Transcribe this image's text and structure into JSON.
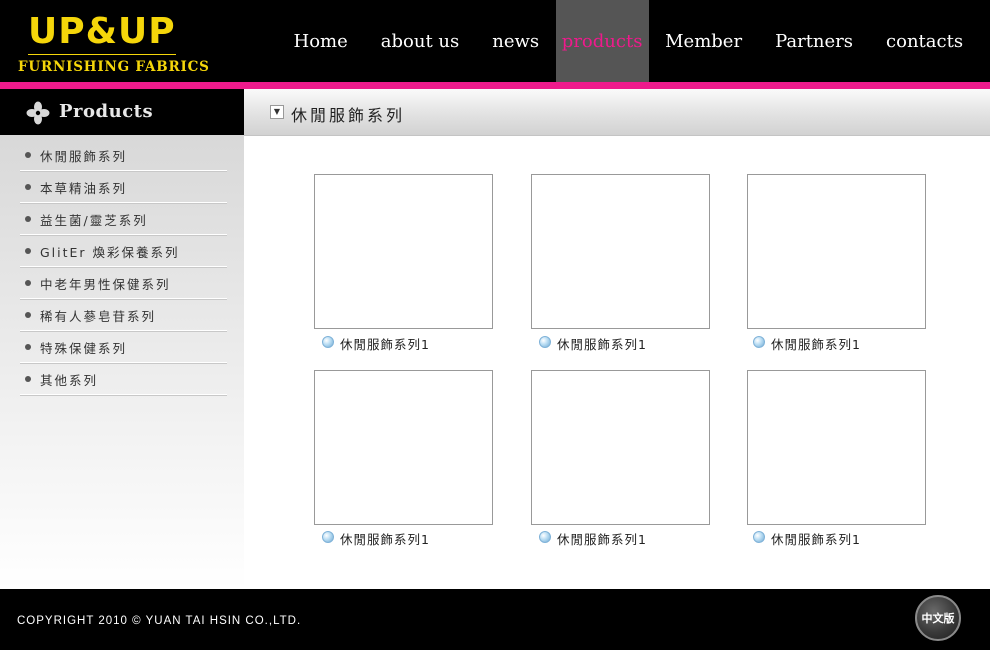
{
  "brand": {
    "logo_main": "UP&UP",
    "logo_sub": "FURNISHING FABRICS",
    "logo_color": "#f5d60a",
    "accent_color": "#ee1a8c"
  },
  "nav": {
    "items": [
      {
        "label": "Home"
      },
      {
        "label": "about us"
      },
      {
        "label": "news"
      },
      {
        "label": "products",
        "active": true
      },
      {
        "label": "Member"
      },
      {
        "label": "Partners"
      },
      {
        "label": "contacts"
      }
    ]
  },
  "sidebar": {
    "title": "Products",
    "icon": "flower-icon",
    "items": [
      {
        "label": "休閒服飾系列"
      },
      {
        "label": "本草精油系列"
      },
      {
        "label": "益生菌/靈芝系列"
      },
      {
        "label": "GlitEr 煥彩保養系列"
      },
      {
        "label": "中老年男性保健系列"
      },
      {
        "label": "稀有人蔘皂苷系列"
      },
      {
        "label": "特殊保健系列"
      },
      {
        "label": "其他系列"
      }
    ]
  },
  "content": {
    "title": "休閒服飾系列",
    "toggle_icon": "dropdown-toggle-icon",
    "products": [
      {
        "caption": "休閒服飾系列1"
      },
      {
        "caption": "休閒服飾系列1"
      },
      {
        "caption": "休閒服飾系列1"
      },
      {
        "caption": "休閒服飾系列1"
      },
      {
        "caption": "休閒服飾系列1"
      },
      {
        "caption": "休閒服飾系列1"
      }
    ]
  },
  "footer": {
    "copyright": "COPYRIGHT 2010  © YUAN TAI HSIN  CO.,LTD.",
    "lang_button": "中文版"
  }
}
